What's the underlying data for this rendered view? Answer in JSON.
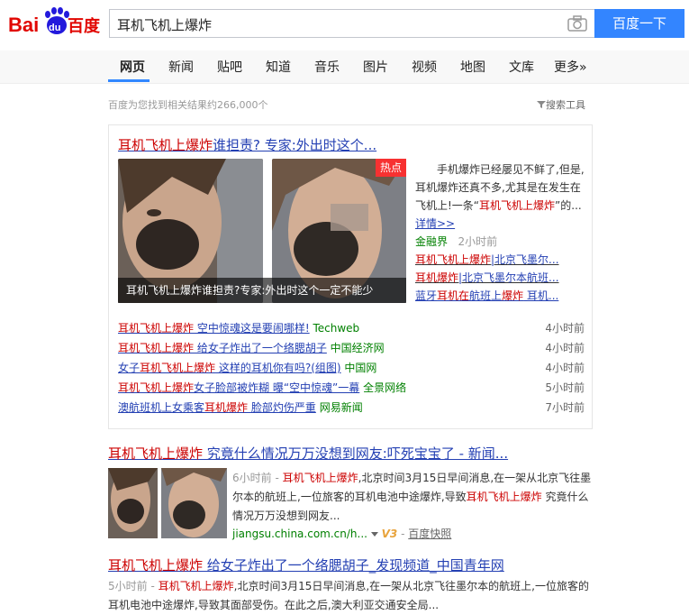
{
  "search": {
    "query": "耳机飞机上爆炸",
    "button_label": "百度一下"
  },
  "logo": {
    "bai": "Bai",
    "du": "du",
    "cn": "百度"
  },
  "tabs": [
    "网页",
    "新闻",
    "贴吧",
    "知道",
    "音乐",
    "图片",
    "视频",
    "地图",
    "文库",
    "更多»"
  ],
  "stats": {
    "text": "百度为您找到相关结果约266,000个",
    "tools": "搜索工具"
  },
  "news_card": {
    "title_red": "耳机飞机上爆炸",
    "title_rest": "谁担责? 专家:外出时这个...",
    "hot_badge": "热点",
    "caption": "耳机飞机上爆炸谁担责?专家:外出时这个一定不能少",
    "summary_a": "手机爆炸已经屡见不鲜了,但是,耳机爆炸还真不多,尤其是在发生在飞机上!一条“",
    "summary_red": "耳机飞机上爆炸",
    "summary_b": "”的...",
    "detail_link": "详情>>",
    "source": "金融界",
    "time": "2小时前",
    "side_links": [
      {
        "red": "耳机飞机上爆炸",
        "rest": "|北京飞墨尔..."
      },
      {
        "red": "耳机爆炸",
        "rest": "|北京飞墨尔本航班..."
      },
      {
        "pre": "蓝牙",
        "red": "耳机在",
        "mid": "航班上",
        "red2": "爆炸",
        "rest": " 耳机..."
      }
    ],
    "list": [
      {
        "red": "耳机飞机上爆炸",
        "rest": " 空中惊魂这是要闹哪样!",
        "source": "Techweb",
        "time": "4小时前"
      },
      {
        "red": "耳机飞机上爆炸",
        "rest": " 给女子炸出了一个络腮胡子",
        "source": "中国经济网",
        "time": "4小时前"
      },
      {
        "pre": "女子",
        "red": "耳机飞机上爆炸",
        "rest": " 这样的耳机你有吗?(组图)",
        "source": "中国网",
        "time": "4小时前"
      },
      {
        "red": "耳机飞机上爆炸",
        "rest": "女子脸部被炸糊 曝“空中惊魂”一幕",
        "source": "全景网络",
        "time": "5小时前"
      },
      {
        "pre": "澳航班机上女乘客",
        "red": "耳机爆炸",
        "rest": " 脸部灼伤严重",
        "source": "网易新闻",
        "time": "7小时前"
      }
    ]
  },
  "result2": {
    "title_red": "耳机飞机上爆炸",
    "title_rest": " 究竟什么情况万万没想到网友:吓死宝宝了 - 新闻...",
    "time": "6小时前",
    "sep": " - ",
    "text_red1": "耳机飞机上爆炸",
    "text_a": ",北京时间3月15日早间消息,在一架从北京飞往墨尔本的航班上,一位旅客的耳机电池中途爆炸,导致",
    "text_red2": "耳机飞机上爆炸",
    "text_b": " 究竟什么情况万万没想到网友...",
    "url": "jiangsu.china.com.cn/h...",
    "v_badge": "V3",
    "snapshot": "百度快照"
  },
  "result3": {
    "title_red": "耳机飞机上爆炸",
    "title_rest": " 给女子炸出了一个络腮胡子_发现频道_中国青年网",
    "time": "5小时前",
    "sep": " - ",
    "text_red": "耳机飞机上爆炸",
    "text": ",北京时间3月15日早间消息,在一架从北京飞往墨尔本的航班上,一位旅客的耳机电池中途爆炸,导致其面部受伤。在此之后,澳大利亚交通安全局..."
  }
}
